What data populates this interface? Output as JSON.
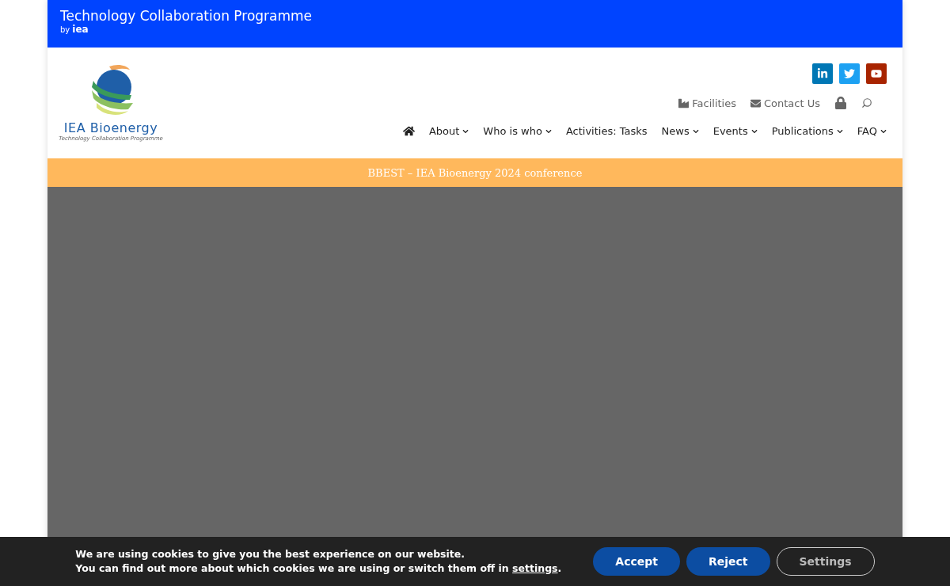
{
  "top_bar": {
    "title": "Technology Collaboration Programme",
    "by": "by",
    "brand": "iea"
  },
  "logo": {
    "name": "IEA Bioenergy",
    "tagline": "Technology Collaboration Programme"
  },
  "social": [
    {
      "kind": "linkedin",
      "color": "#0077b5"
    },
    {
      "kind": "twitter",
      "color": "#1da1f2"
    },
    {
      "kind": "youtube",
      "color": "#a82400"
    }
  ],
  "secondary_nav": [
    {
      "kind": "facilities",
      "label": "Facilities"
    },
    {
      "kind": "contact",
      "label": "Contact Us"
    }
  ],
  "main_nav": [
    {
      "label": "About",
      "dropdown": true
    },
    {
      "label": "Who is who",
      "dropdown": true
    },
    {
      "label": "Activities: Tasks",
      "dropdown": false
    },
    {
      "label": "News",
      "dropdown": true
    },
    {
      "label": "Events",
      "dropdown": true
    },
    {
      "label": "Publications",
      "dropdown": true
    },
    {
      "label": "FAQ",
      "dropdown": true
    }
  ],
  "banner": {
    "text": "BBEST – IEA Bioenergy 2024 conference"
  },
  "cookie_bar": {
    "line_1": "We are using cookies to give you the best experience on our website.",
    "line_2": "You can find out more about which cookies we are using or switch them off in",
    "link": "settings",
    "end": ".",
    "buttons": [
      {
        "label": "Accept",
        "kind": "primary"
      },
      {
        "label": "Reject",
        "kind": "primary"
      },
      {
        "label": "Settings",
        "kind": "outline"
      }
    ]
  }
}
